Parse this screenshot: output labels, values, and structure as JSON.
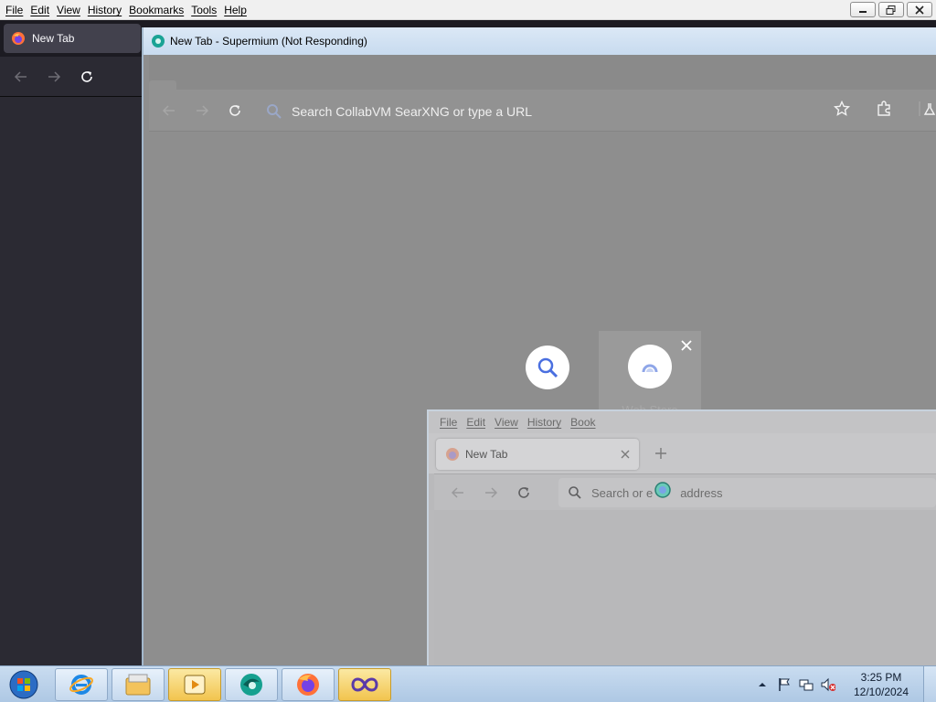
{
  "firefox": {
    "menu": [
      "File",
      "Edit",
      "View",
      "History",
      "Bookmarks",
      "Tools",
      "Help"
    ],
    "tab_title": "New Tab"
  },
  "supermium": {
    "window_title": "New Tab - Supermium (Not Responding)",
    "omnibox_placeholder": "Search CollabVM SearXNG or type a URL",
    "shortcuts": [
      {
        "label": "",
        "icon": "search-icon"
      },
      {
        "label": "Web Store",
        "icon": "web-store-icon"
      }
    ]
  },
  "firefox_inner": {
    "menu": [
      "File",
      "Edit",
      "View",
      "History",
      "Book"
    ],
    "tab_title": "New Tab",
    "urlbar_placeholder_left": "Search or e",
    "urlbar_placeholder_right": "address"
  },
  "taskbar": {
    "pinned": [
      "internet-explorer-icon",
      "file-explorer-icon",
      "media-player-icon",
      "supermium-icon",
      "firefox-icon",
      "visual-studio-icon"
    ],
    "time": "3:25 PM",
    "date": "12/10/2024"
  },
  "colors": {
    "firefox_dark": "#2b2a33",
    "supermium_bg": "#8e8e8e",
    "taskbar_active": "#f2c44e"
  }
}
